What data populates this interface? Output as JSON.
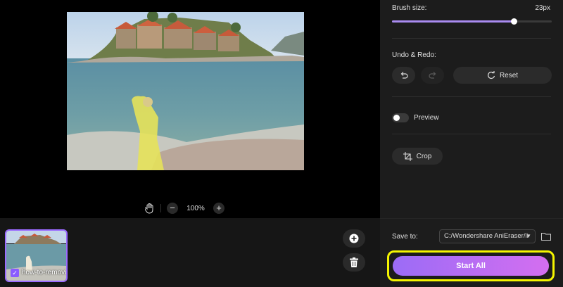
{
  "canvas": {
    "zoom_value": "100%",
    "icons": {
      "hand": "hand-icon",
      "zoom_out": "minus-icon",
      "zoom_in": "plus-icon"
    }
  },
  "filmstrip": {
    "thumbnail_name": "how-to-removi",
    "thumbnail_checked": true,
    "add_button_icon": "plus-circle-icon",
    "delete_button_icon": "trash-icon"
  },
  "panel": {
    "brush_size_label": "Brush size:",
    "brush_size_value": "23px",
    "brush_size_fraction": 0.76,
    "undo_redo_label": "Undo & Redo:",
    "undo_icon": "undo-icon",
    "redo_icon": "redo-icon",
    "reset_label": "Reset",
    "preview_label": "Preview",
    "preview_on": false,
    "crop_label": "Crop",
    "save_to_label": "Save to:",
    "save_path": "C:/Wondershare AniEraser/li",
    "folder_icon": "folder-icon",
    "start_label": "Start All"
  },
  "colors": {
    "accent": "#9b6cf6",
    "accent_end": "#d46ef0",
    "highlight": "#f5f500",
    "panel_bg": "#1c1c1c"
  }
}
